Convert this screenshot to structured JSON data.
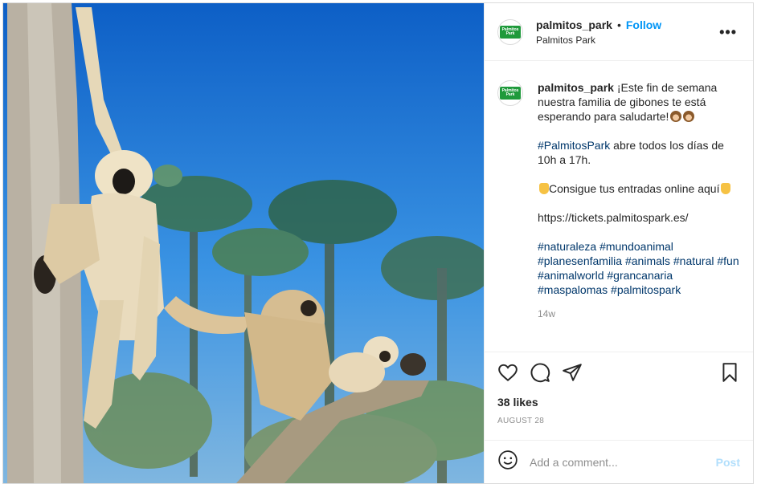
{
  "post": {
    "image_alt": "Gibbons on a tree with palm trees and blue sky"
  },
  "header": {
    "username": "palmitos_park",
    "separator": "•",
    "follow_label": "Follow",
    "location": "Palmitos Park",
    "more_label": "•••",
    "avatar_text": "Palmitos Park"
  },
  "caption": {
    "username": "palmitos_park",
    "line1": "¡Este fin de semana nuestra familia de gibones te está esperando para saludarte!",
    "line2_tag": "#PalmitosPark",
    "line2_text": " abre todos los días de 10h a 17h.",
    "line3": "Consigue tus entradas online aquí",
    "link": "https://tickets.palmitospark.es/",
    "hashtags": [
      "#naturaleza",
      "#mundoanimal",
      "#planesenfamilia",
      "#animals",
      "#natural",
      "#fun",
      "#animalworld",
      "#grancanaria",
      "#maspalomas",
      "#palmitospark"
    ],
    "timestamp": "14w"
  },
  "actions": {
    "likes": "38 likes",
    "date": "AUGUST 28"
  },
  "comment_box": {
    "placeholder": "Add a comment...",
    "post_label": "Post"
  },
  "icons": {
    "like": "heart-icon",
    "comment": "comment-icon",
    "share": "share-icon",
    "save": "bookmark-icon",
    "emoji": "emoji-icon"
  },
  "colors": {
    "accent": "#0095f6",
    "hashtag": "#00376b",
    "muted": "#8e8e8e",
    "post_disabled": "#b2dffc",
    "brand": "#1f9a3b"
  }
}
